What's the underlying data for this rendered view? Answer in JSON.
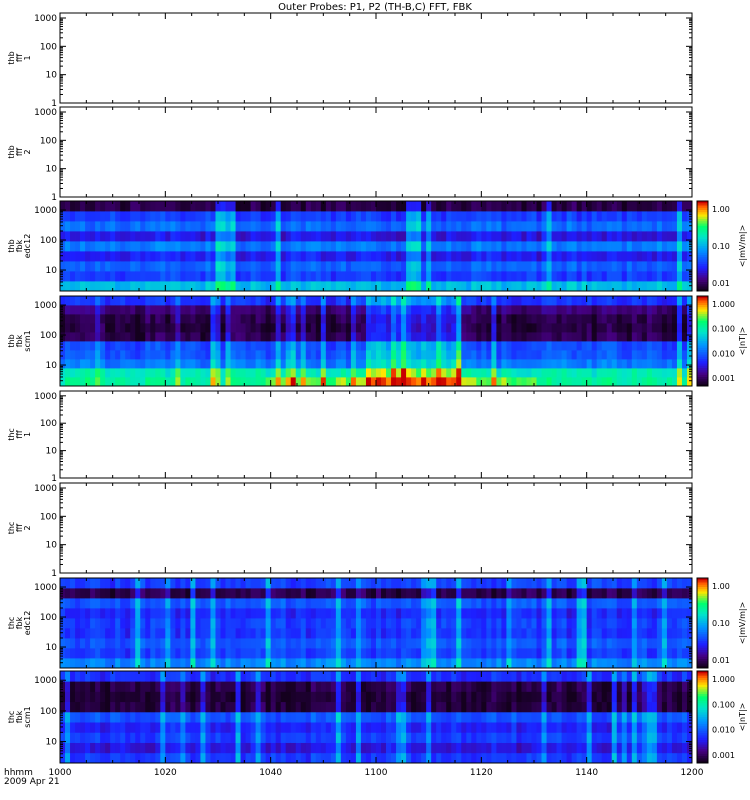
{
  "title": "Outer Probes: P1, P2 (TH-B,C) FFT, FBK",
  "time_axis": {
    "corner_label_1": "hhmm",
    "corner_label_2": "2009 Apr 21",
    "ticks": [
      "1000",
      "1020",
      "1040",
      "1100",
      "1120",
      "1140",
      "1200"
    ]
  },
  "colorbar_labels": {
    "edc12": [
      "1.00",
      "0.10",
      "0.01"
    ],
    "scm1": [
      "1.000",
      "0.100",
      "0.010",
      "0.001"
    ]
  },
  "colors": {
    "blue": "#1e22ff",
    "dark": "#150022",
    "cyan": "#00c0ff",
    "green": "#00ff7f",
    "yellow": "#ffe600"
  },
  "chart_data": [
    {
      "type": "heatmap",
      "panel_id": "thb_fff_1",
      "ylabel": [
        "thb",
        "fff",
        "1"
      ],
      "yticks": [
        "1000",
        "100",
        "10",
        "1"
      ],
      "ylog": true,
      "ylim": [
        1,
        1500
      ],
      "has_data": false
    },
    {
      "type": "heatmap",
      "panel_id": "thb_fff_2",
      "ylabel": [
        "thb",
        "fff",
        "2"
      ],
      "yticks": [
        "1000",
        "100",
        "10",
        "1"
      ],
      "ylog": true,
      "ylim": [
        1,
        1500
      ],
      "has_data": false
    },
    {
      "type": "heatmap",
      "panel_id": "thb_fbk_edc12",
      "ylabel": [
        "thb",
        "fbk",
        "edc12"
      ],
      "yticks": [
        "1000",
        "100",
        "10"
      ],
      "ylog": true,
      "ylim": [
        2,
        2000
      ],
      "has_data": true,
      "colorbar_unit": "<|mV/m|>",
      "colorbar_ticks": [
        "1.00",
        "0.10",
        "0.01"
      ],
      "time_range": [
        "1000",
        "1200"
      ]
    },
    {
      "type": "heatmap",
      "panel_id": "thb_fbk_scm1",
      "ylabel": [
        "thb",
        "fbk",
        "scm1"
      ],
      "yticks": [
        "1000",
        "100",
        "10"
      ],
      "ylog": true,
      "ylim": [
        2,
        2000
      ],
      "has_data": true,
      "colorbar_unit": "<|nT|>",
      "colorbar_ticks": [
        "1.000",
        "0.100",
        "0.010",
        "0.001"
      ],
      "time_range": [
        "1000",
        "1200"
      ]
    },
    {
      "type": "heatmap",
      "panel_id": "thc_fff_1",
      "ylabel": [
        "thc",
        "fff",
        "1"
      ],
      "yticks": [
        "1000",
        "100",
        "10",
        "1"
      ],
      "ylog": true,
      "ylim": [
        1,
        1500
      ],
      "has_data": false
    },
    {
      "type": "heatmap",
      "panel_id": "thc_fff_2",
      "ylabel": [
        "thc",
        "fff",
        "2"
      ],
      "yticks": [
        "1000",
        "100",
        "10",
        "1"
      ],
      "ylog": true,
      "ylim": [
        1,
        1500
      ],
      "has_data": false
    },
    {
      "type": "heatmap",
      "panel_id": "thc_fbk_edc12",
      "ylabel": [
        "thc",
        "fbk",
        "edc12"
      ],
      "yticks": [
        "1000",
        "100",
        "10"
      ],
      "ylog": true,
      "ylim": [
        2,
        2000
      ],
      "has_data": true,
      "colorbar_unit": "<|mV/m|>",
      "colorbar_ticks": [
        "1.00",
        "0.10",
        "0.01"
      ],
      "time_range": [
        "1000",
        "1200"
      ]
    },
    {
      "type": "heatmap",
      "panel_id": "thc_fbk_scm1",
      "ylabel": [
        "thc",
        "fbk",
        "scm1"
      ],
      "yticks": [
        "1000",
        "100",
        "10"
      ],
      "ylog": true,
      "ylim": [
        2,
        2000
      ],
      "has_data": true,
      "colorbar_unit": "<|nT|>",
      "colorbar_ticks": [
        "1.000",
        "0.100",
        "0.010",
        "0.001"
      ],
      "time_range": [
        "1000",
        "1200"
      ]
    }
  ]
}
